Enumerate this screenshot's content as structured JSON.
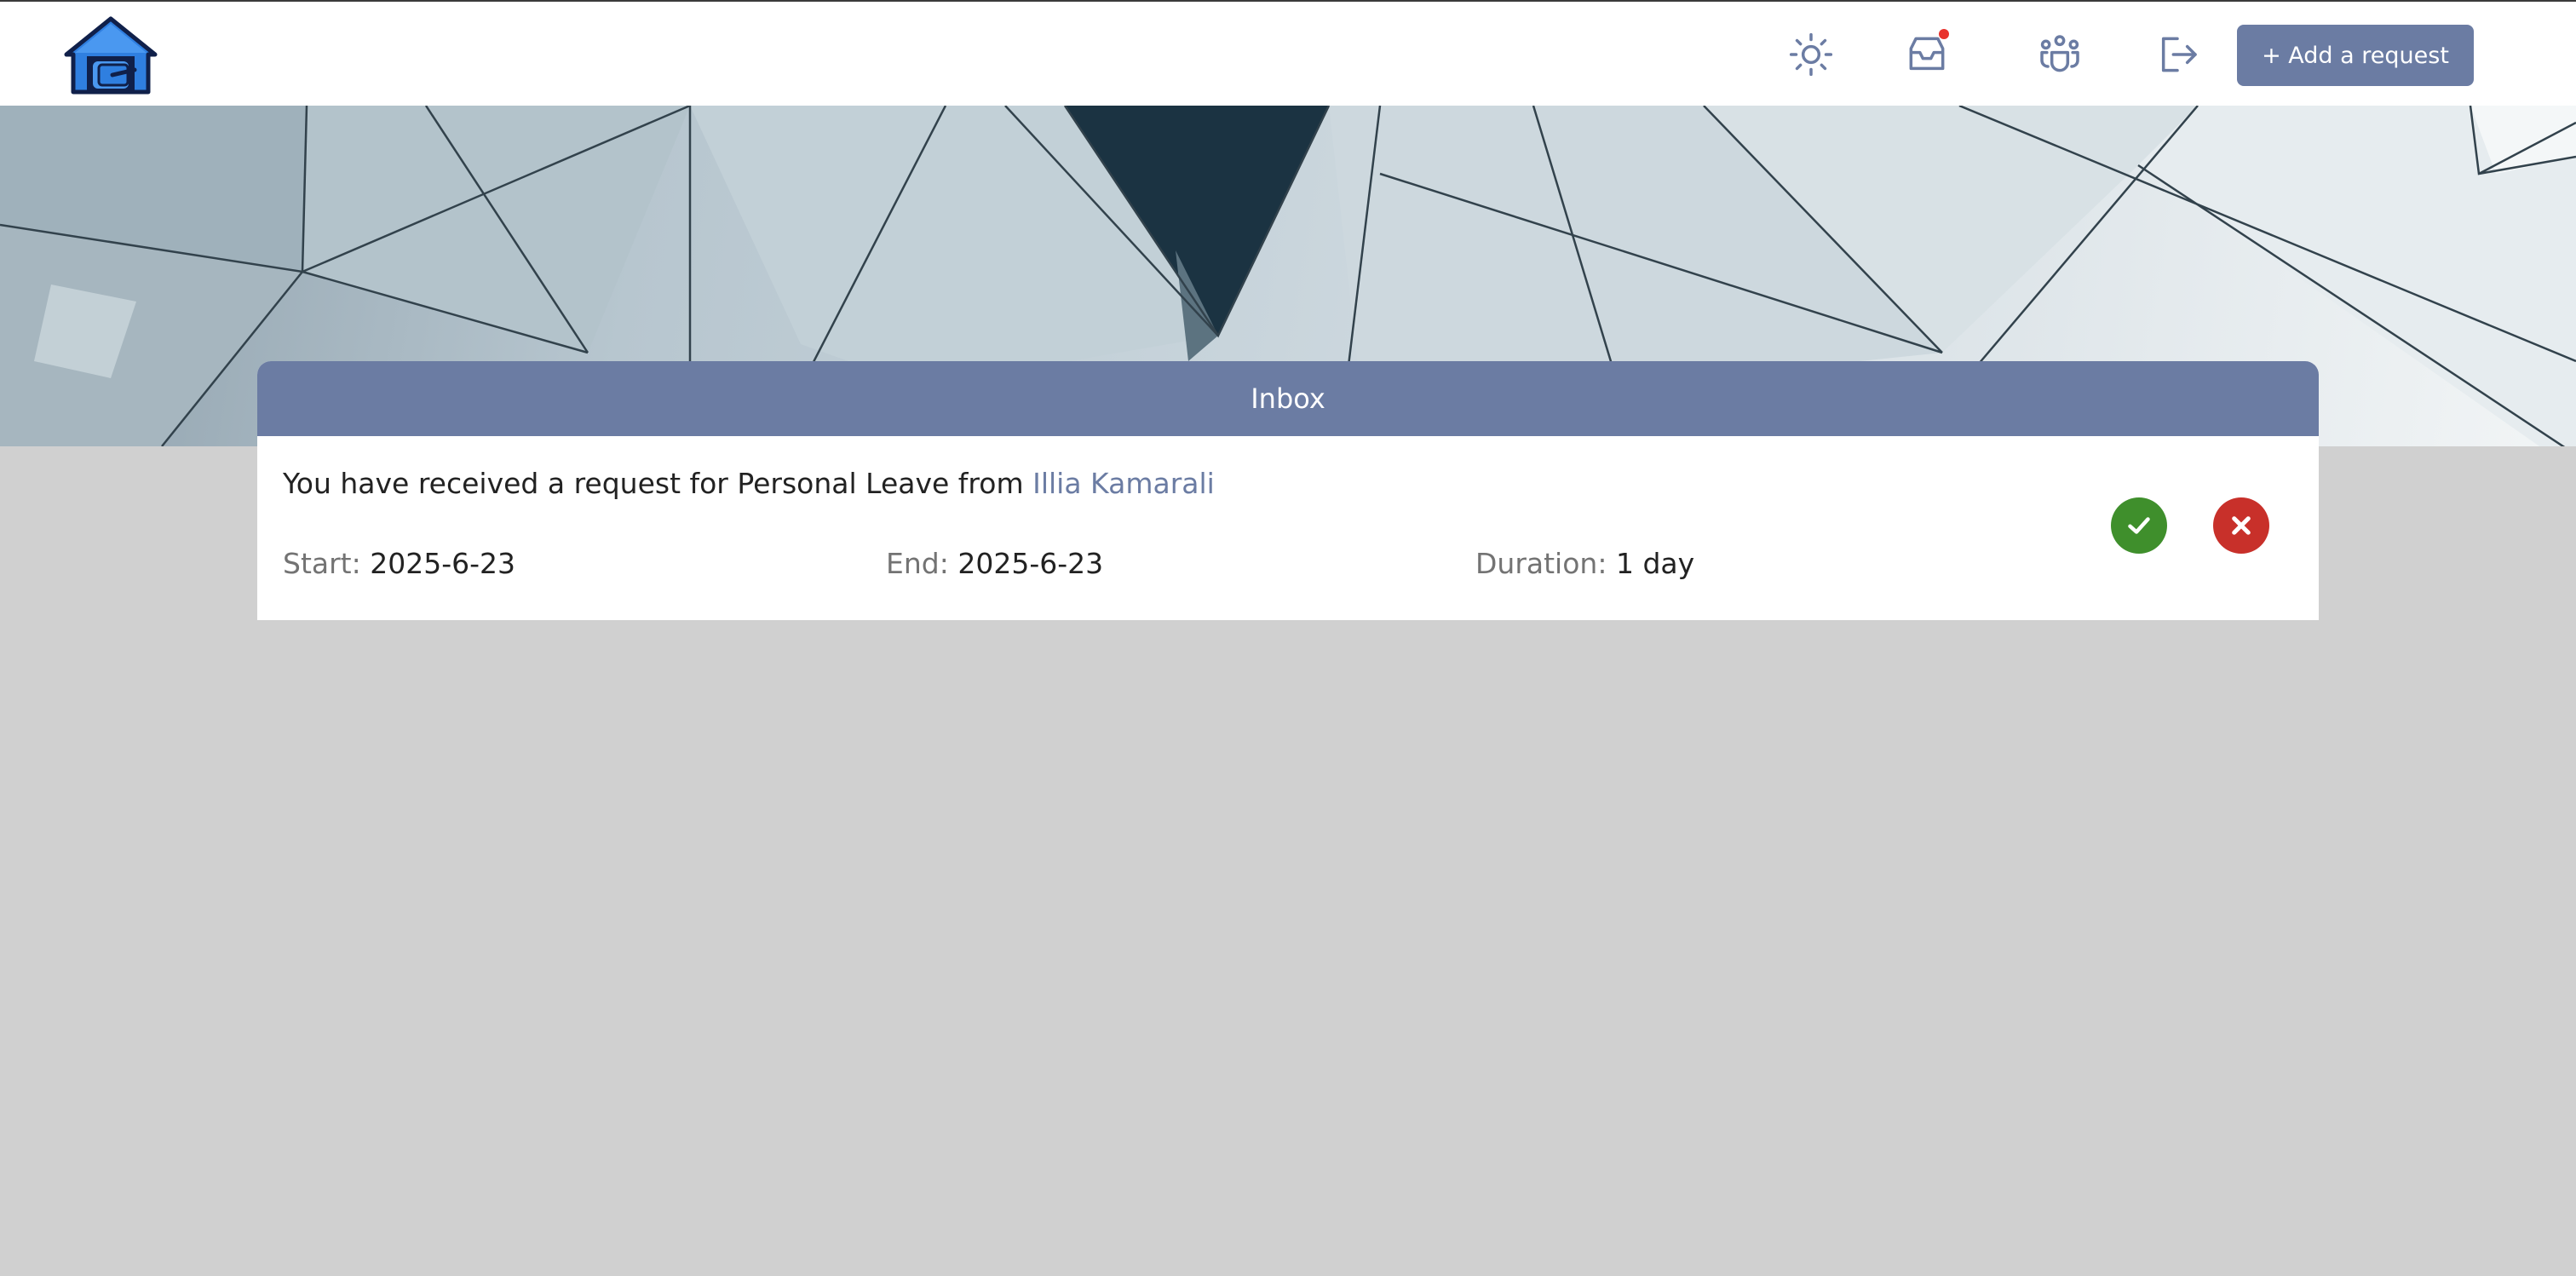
{
  "header": {
    "logo_icon": "house-logo-icon",
    "icons": [
      "sun-icon",
      "inbox-icon",
      "team-icon",
      "logout-icon"
    ],
    "add_request_label": "+ Add a request"
  },
  "inbox": {
    "title": "Inbox",
    "request": {
      "message_prefix": "You have received a request for Personal Leave from",
      "sender": "Illia Kamarali",
      "start_label": "Start:",
      "start_value": "2025-6-23",
      "end_label": "End:",
      "end_value": "2025-6-23",
      "duration_label": "Duration:",
      "duration_value": "1 day",
      "approve_icon": "check-icon",
      "reject_icon": "close-icon"
    }
  },
  "colors": {
    "accent": "#6b7ca3",
    "approve": "#3f8f2c",
    "reject": "#c8302a",
    "notification": "#e8322c",
    "page_background": "#d0d0d0"
  }
}
